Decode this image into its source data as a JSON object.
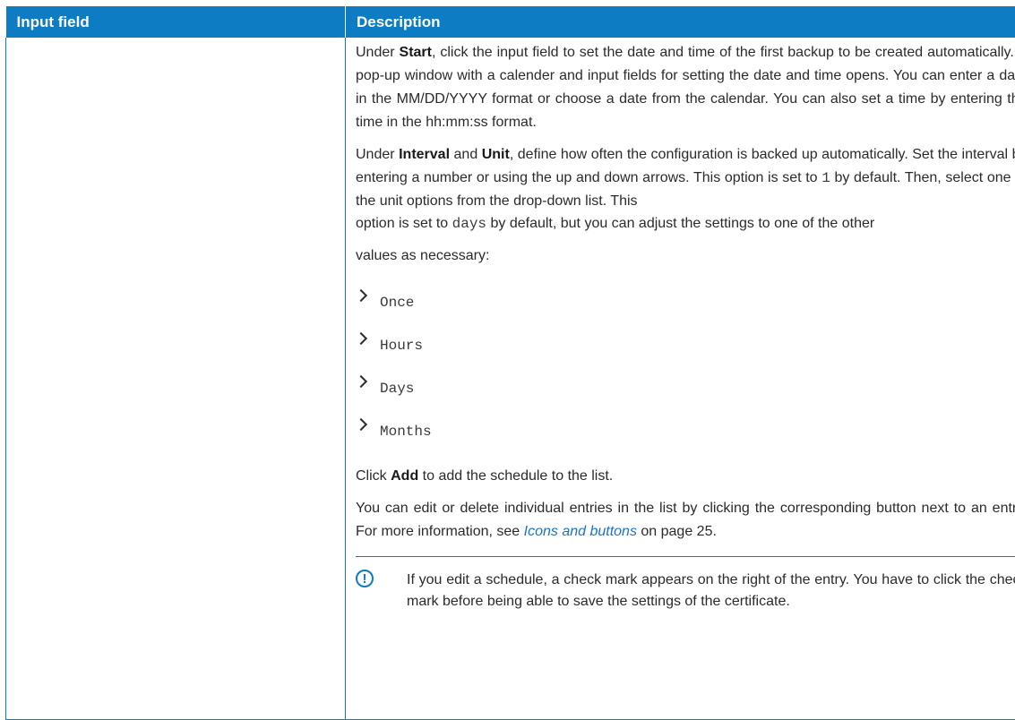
{
  "table": {
    "header_col1": "Input field",
    "header_col2": "Description"
  },
  "para1": {
    "t1": "Under ",
    "b1": "Start",
    "t2": ", click the input field to set the date and time of the first backup to be created automatically. A pop-up window with a calender and input fields for setting the date and time opens. You can enter a date in the MM/DD/YYYY format or choose a date from the calendar. You can also set a time by entering the time in the hh:mm:ss format."
  },
  "para2": {
    "t1": "Under ",
    "b1": "Interval",
    "t2": " and ",
    "b2": "Unit",
    "t3": ", define how often the configuration is backed up automatically. Set the interval by entering a number or using the up and down arrows. This option is set to ",
    "code1": "1",
    "t4": " by default. Then, select one of the unit options from the drop-down list. This",
    "t5": "option is set to ",
    "code2": "days",
    "t6": " by default, but you can adjust the settings to one of the other",
    "t7": "values as necessary:"
  },
  "units": [
    "Once",
    "Hours",
    "Days",
    "Months"
  ],
  "para3": {
    "t1": "Click ",
    "b1": "Add",
    "t2": " to add the schedule to the list."
  },
  "para4": {
    "t1": "You can edit or delete individual entries in the list by clicking the corresponding button next to an entry. For more information, see ",
    "link": "Icons and buttons",
    "t2": " on page 25."
  },
  "note": {
    "icon": "!",
    "text": "If you edit a schedule, a check mark appears on the right of the entry. You have to click the check mark before being able to save the settings of the certificate."
  },
  "colors": {
    "header_bg": "#0d7cc2",
    "link": "#1a73c8"
  }
}
